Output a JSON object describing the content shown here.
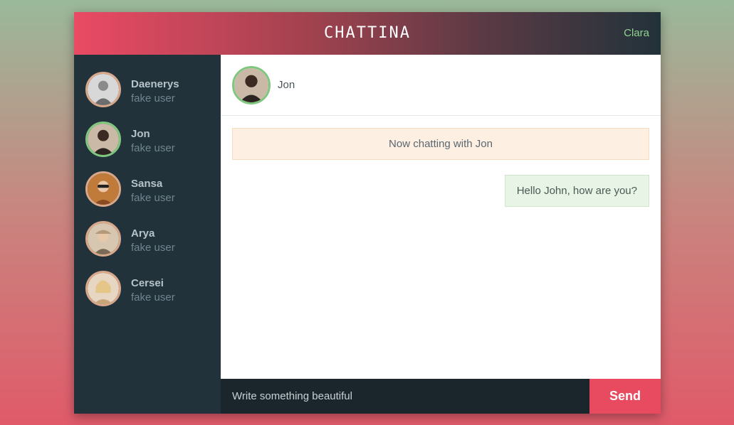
{
  "header": {
    "title": "CHATTINA",
    "current_user": "Clara"
  },
  "contacts": [
    {
      "name": "Daenerys",
      "subtitle": "fake user",
      "active": false
    },
    {
      "name": "Jon",
      "subtitle": "fake user",
      "active": true
    },
    {
      "name": "Sansa",
      "subtitle": "fake user",
      "active": false
    },
    {
      "name": "Arya",
      "subtitle": "fake user",
      "active": false
    },
    {
      "name": "Cersei",
      "subtitle": "fake user",
      "active": false
    }
  ],
  "chat": {
    "contact_name": "Jon",
    "system_message": "Now chatting with Jon",
    "messages": [
      {
        "text": "Hello John, how are you?",
        "from": "me"
      }
    ]
  },
  "composer": {
    "placeholder": "Write something beautiful",
    "send_label": "Send"
  },
  "colors": {
    "accent": "#e84a60",
    "online": "#7fc77f",
    "sidebar": "#22323a"
  }
}
